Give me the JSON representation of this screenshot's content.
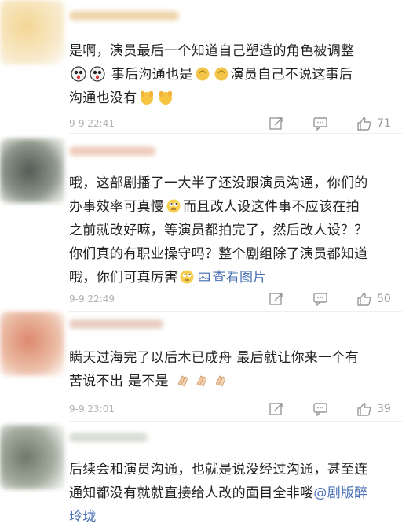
{
  "comments": [
    {
      "text_parts": [
        "是啊，演员最后一个知道自己塑造的角色被调整",
        " 事后沟通也是",
        "演员自己不说这事后",
        "沟通也没有"
      ],
      "time": "9-9 22:41",
      "likes": "71",
      "avatar_color": "#f0d89a",
      "emoji_names": [
        "shocked-face-emoji",
        "shrug-hand-emoji",
        "hands-up-emoji"
      ]
    },
    {
      "text_parts": [
        "哦，这部剧播了一大半了还没跟演员沟通，你们的",
        "办事效率可真慢",
        "而且改人设这件事不应该在拍",
        "之前就改好嘛，等演员都拍完了，然后改人设？？",
        "你们真的有职业操守吗？整个剧组除了演员都知道",
        "哦，你们可真厉害",
        "查看图片"
      ],
      "time": "9-9 22:49",
      "likes": "50",
      "avatar_color": "#5a6a5c",
      "emoji_names": [
        "rolling-eyes-emoji",
        "image-icon"
      ]
    },
    {
      "text_parts": [
        "瞒天过海完了以后木已成舟 最后就让你来一个有",
        "苦说不出 是不是"
      ],
      "time": "9-9 23:01",
      "likes": "39",
      "avatar_color": "#e29a7e",
      "emoji_names": [
        "clapping-hands-emoji"
      ]
    },
    {
      "text_parts": [
        "后续会和演员沟通，也就是说没经过沟通，甚至连",
        "通知都没有就就直接给人改的面目全非喽",
        "@剧版醉",
        "玲珑"
      ],
      "avatar_color": "#6f7a6a"
    }
  ]
}
